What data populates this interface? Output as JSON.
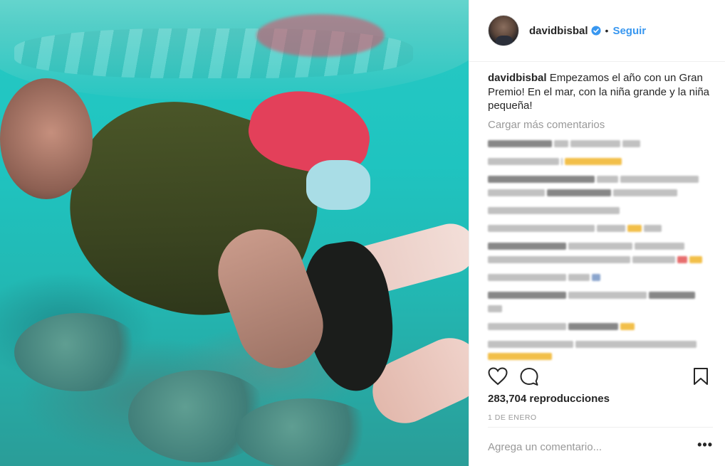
{
  "post": {
    "author": "davidbisbal",
    "verified": true,
    "follow_label": "Seguir",
    "separator": "•",
    "caption_user": "davidbisbal",
    "caption_text": " Empezamos el año con un Gran Premio! En el mar, con la niña grande y la niña pequeña!",
    "load_more_label": "Cargar más comentarios",
    "views": "283,704 reproducciones",
    "date": "1 DE ENERO",
    "comment_placeholder": "Agrega un comentario...",
    "more_options": "•••"
  },
  "icons": {
    "heart": "heart-icon",
    "comment": "comment-icon",
    "bookmark": "bookmark-icon",
    "verified": "verified-badge-icon"
  },
  "colors": {
    "link_blue": "#3897f0",
    "text": "#262626",
    "muted": "#999999",
    "border": "#efefef"
  }
}
